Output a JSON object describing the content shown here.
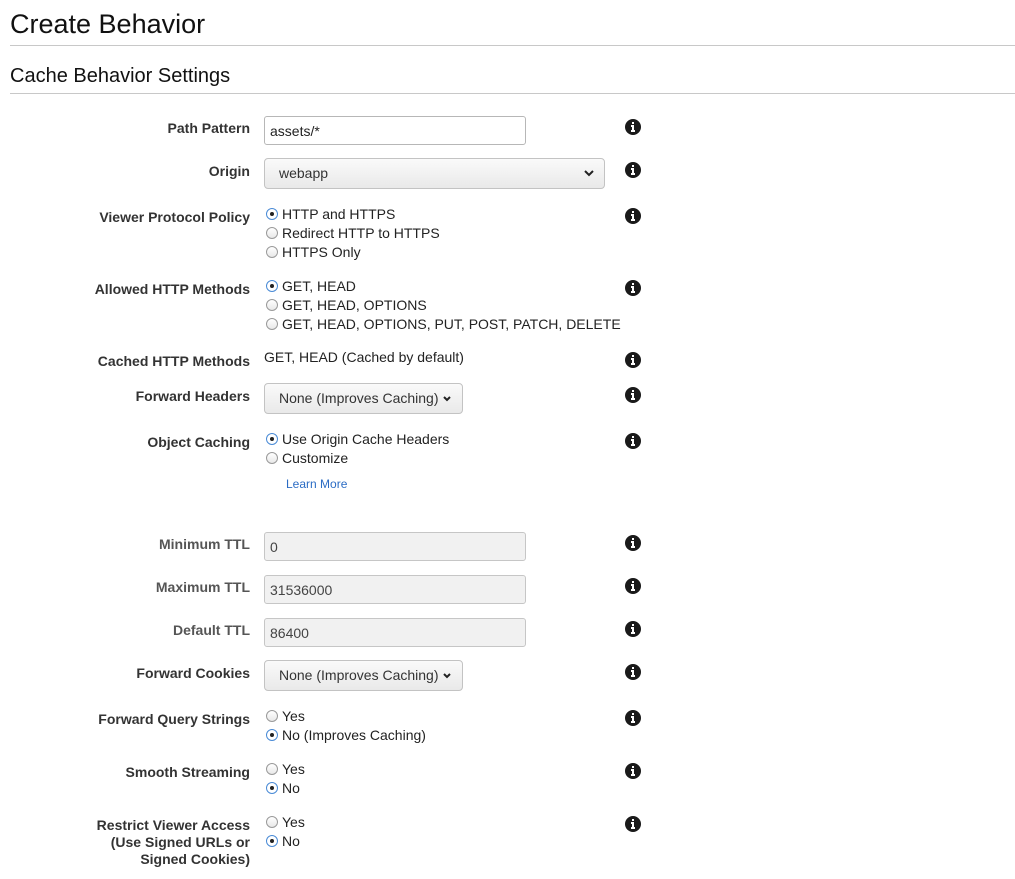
{
  "page_title": "Create Behavior",
  "section_title": "Cache Behavior Settings",
  "path_pattern": {
    "label": "Path Pattern",
    "value": "assets/*"
  },
  "origin": {
    "label": "Origin",
    "selected": "webapp"
  },
  "viewer_protocol_policy": {
    "label": "Viewer Protocol Policy",
    "options": [
      "HTTP and HTTPS",
      "Redirect HTTP to HTTPS",
      "HTTPS Only"
    ],
    "selected_index": 0
  },
  "allowed_http_methods": {
    "label": "Allowed HTTP Methods",
    "options": [
      "GET, HEAD",
      "GET, HEAD, OPTIONS",
      "GET, HEAD, OPTIONS, PUT, POST, PATCH, DELETE"
    ],
    "selected_index": 0
  },
  "cached_http_methods": {
    "label": "Cached HTTP Methods",
    "value": "GET, HEAD (Cached by default)"
  },
  "forward_headers": {
    "label": "Forward Headers",
    "selected": "None (Improves Caching)"
  },
  "object_caching": {
    "label": "Object Caching",
    "options": [
      "Use Origin Cache Headers",
      "Customize"
    ],
    "selected_index": 0,
    "learn_more": "Learn More"
  },
  "minimum_ttl": {
    "label": "Minimum TTL",
    "value": "0"
  },
  "maximum_ttl": {
    "label": "Maximum TTL",
    "value": "31536000"
  },
  "default_ttl": {
    "label": "Default TTL",
    "value": "86400"
  },
  "forward_cookies": {
    "label": "Forward Cookies",
    "selected": "None (Improves Caching)"
  },
  "forward_query_strings": {
    "label": "Forward Query Strings",
    "options": [
      "Yes",
      "No (Improves Caching)"
    ],
    "selected_index": 1
  },
  "smooth_streaming": {
    "label": "Smooth Streaming",
    "options": [
      "Yes",
      "No"
    ],
    "selected_index": 1
  },
  "restrict_viewer_access": {
    "label_lines": [
      "Restrict Viewer Access",
      "(Use Signed URLs or",
      "Signed Cookies)"
    ],
    "options": [
      "Yes",
      "No"
    ],
    "selected_index": 1
  },
  "icons": {
    "info": "info-icon",
    "dropdown": "chevron-down-icon"
  }
}
